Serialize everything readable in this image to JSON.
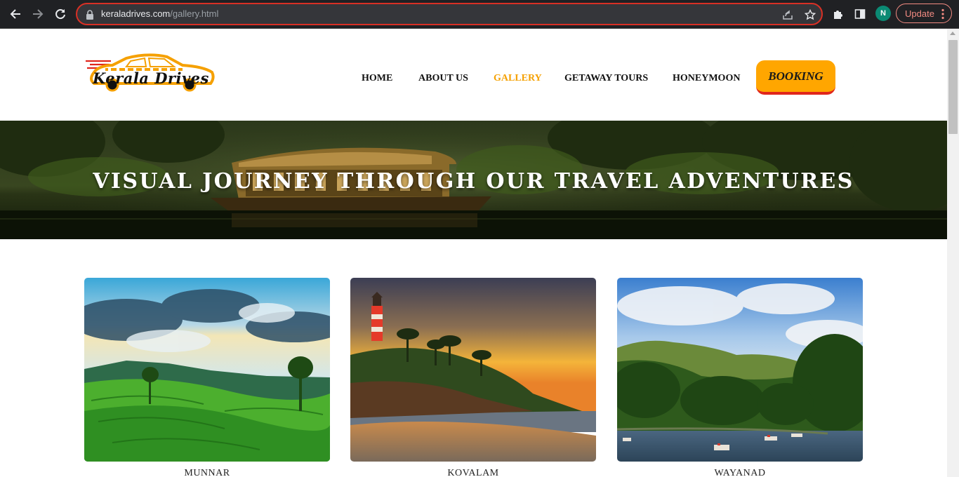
{
  "browser": {
    "url_host": "keraladrives.com",
    "url_path": "/gallery.html",
    "profile_initial": "N",
    "update_label": "Update"
  },
  "site": {
    "logo_text": "Kerala Drives",
    "nav": [
      "HOME",
      "ABOUT US",
      "GALLERY",
      "GETAWAY TOURS",
      "HONEYMOON"
    ],
    "active_nav": "GALLERY",
    "booking_label": "BOOKING"
  },
  "hero": {
    "title": "VISUAL JOURNEY THROUGH OUR TRAVEL ADVENTURES"
  },
  "gallery": [
    {
      "caption": "MUNNAR"
    },
    {
      "caption": "KOVALAM"
    },
    {
      "caption": "WAYANAD"
    }
  ],
  "colors": {
    "accent": "#ffa600",
    "booking_border": "#e0261c",
    "active_nav": "#f5a000",
    "omnibox_border": "#d93025"
  }
}
